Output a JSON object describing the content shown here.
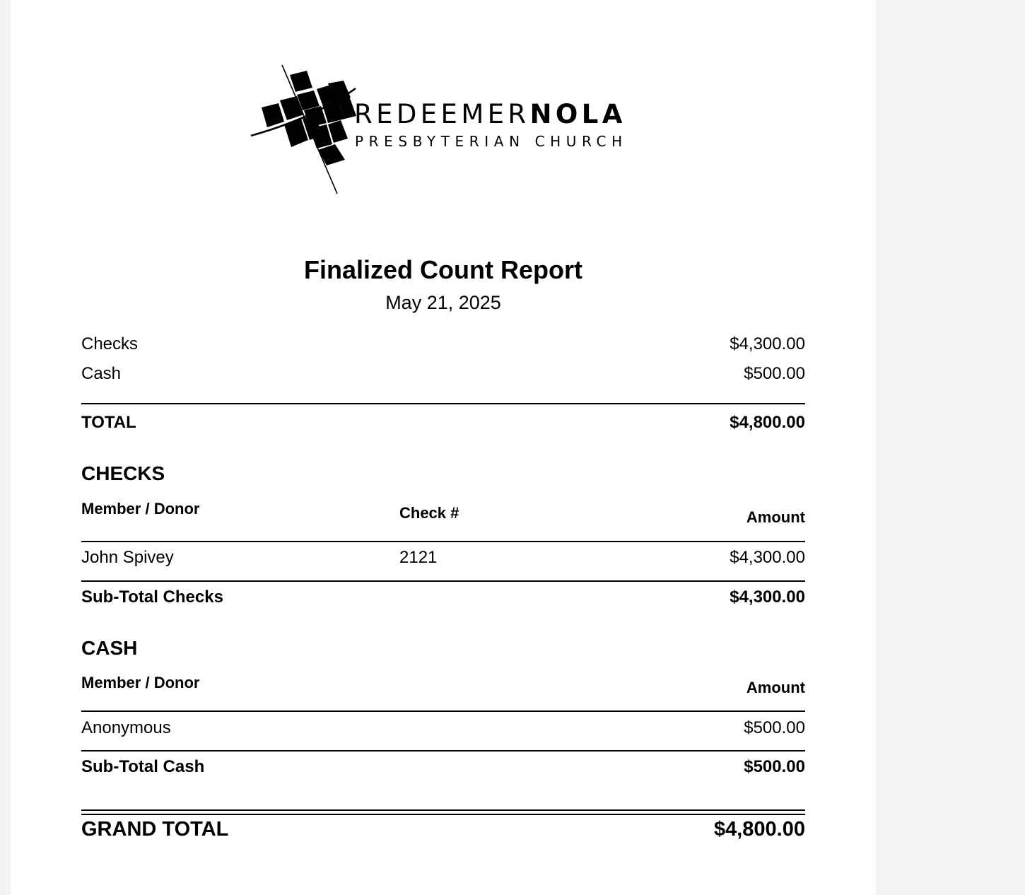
{
  "logo": {
    "name_light": "REDEEMER",
    "name_bold": "NOLA",
    "subtitle": "PRESBYTERIAN CHURCH"
  },
  "report": {
    "title": "Finalized Count Report",
    "date": "May 21, 2025"
  },
  "summary": {
    "rows": [
      {
        "label": "Checks",
        "amount": "$4,300.00"
      },
      {
        "label": "Cash",
        "amount": "$500.00"
      }
    ],
    "total_label": "TOTAL",
    "total_amount": "$4,800.00"
  },
  "checks": {
    "heading": "CHECKS",
    "headers": {
      "donor": "Member / Donor",
      "check_no": "Check #",
      "amount": "Amount"
    },
    "rows": [
      {
        "donor": "John Spivey",
        "check_no": "2121",
        "amount": "$4,300.00"
      }
    ],
    "subtotal_label": "Sub-Total Checks",
    "subtotal_amount": "$4,300.00"
  },
  "cash": {
    "heading": "CASH",
    "headers": {
      "donor": "Member / Donor",
      "amount": "Amount"
    },
    "rows": [
      {
        "donor": "Anonymous",
        "amount": "$500.00"
      }
    ],
    "subtotal_label": "Sub-Total Cash",
    "subtotal_amount": "$500.00"
  },
  "grand_total": {
    "label": "GRAND TOTAL",
    "amount": "$4,800.00"
  }
}
